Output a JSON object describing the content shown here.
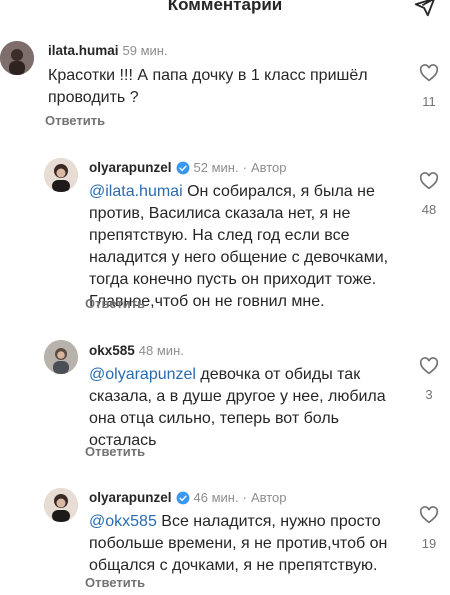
{
  "header": {
    "title": "Комментарии"
  },
  "icons": {
    "send": "send-icon",
    "like": "heart-outline-icon",
    "verified": "verified-badge-icon"
  },
  "colors": {
    "mention": "#2a6bb0",
    "verified": "#3897f0",
    "text": "#262626",
    "muted": "#8e8e8e"
  },
  "comments": [
    {
      "username": "ilata.humai",
      "time": "59 мин.",
      "author_tag": "",
      "mention": "",
      "text": "Красотки !!! А папа дочку в 1 класс пришёл\nпроводить ?",
      "reply_label": "Ответить",
      "likes": "11"
    },
    {
      "username": "olyarapunzel",
      "time": "52 мин.",
      "author_tag": "Автор",
      "mention": "@ilata.humai",
      "text": " Он собирался, я была не\nпротив, Василиса сказала нет, я не\nпрепятствую. На след год если все\nналадится у него общение с девочками,\nтогда конечно пусть он приходит тоже.\nГлавное,чтоб он не говнил мне.",
      "reply_label": "Ответить",
      "likes": "48"
    },
    {
      "username": "okx585",
      "time": "48 мин.",
      "author_tag": "",
      "mention": "@olyarapunzel",
      "text": " девочка от обиды так\nсказала, а в душе другое у нее, любила\nона отца сильно, теперь вот боль\nосталась",
      "reply_label": "Ответить",
      "likes": "3"
    },
    {
      "username": "olyarapunzel",
      "time": "46 мин.",
      "author_tag": "Автор",
      "mention": "@okx585",
      "text": " Все наладится, нужно просто\nпобольше времени, я не против,чтоб он\nобщался с дочками, я не препятствую.",
      "reply_label": "Ответить",
      "likes": "19"
    }
  ]
}
